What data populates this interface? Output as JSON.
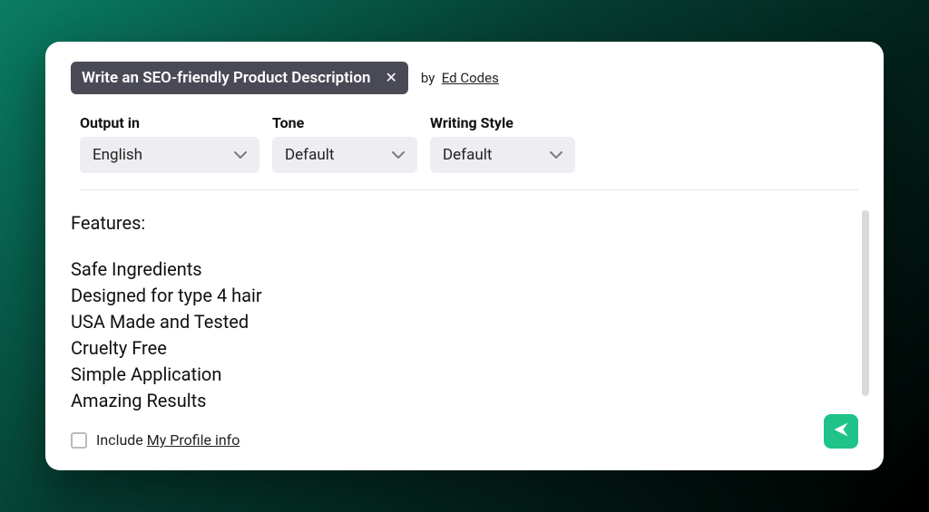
{
  "header": {
    "title": "Write an SEO-friendly Product Description",
    "by_label": "by",
    "author": "Ed Codes"
  },
  "controls": {
    "output": {
      "label": "Output in",
      "value": "English"
    },
    "tone": {
      "label": "Tone",
      "value": "Default"
    },
    "style": {
      "label": "Writing Style",
      "value": "Default"
    }
  },
  "content": {
    "heading": "Features:",
    "features": [
      "Safe Ingredients",
      "Designed for type 4 hair",
      "USA Made and Tested",
      "Cruelty Free",
      "Simple Application",
      "Amazing Results"
    ]
  },
  "footer": {
    "include_prefix": "Include ",
    "include_link": "My Profile info"
  }
}
